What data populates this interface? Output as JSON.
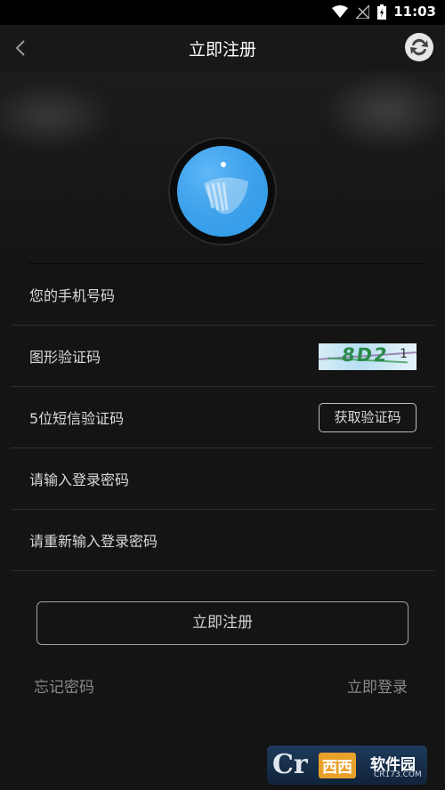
{
  "status_bar": {
    "time": "11:03",
    "icons": [
      "wifi-icon",
      "no-signal-icon",
      "battery-icon"
    ]
  },
  "app_bar": {
    "title": "立即注册",
    "back_icon": "chevron-left-icon",
    "refresh_icon": "refresh-icon"
  },
  "form": {
    "phone_placeholder": "您的手机号码",
    "captcha_placeholder": "图形验证码",
    "captcha_image_text": "8D2",
    "captcha_image_suffix": "1",
    "sms_placeholder": "5位短信验证码",
    "get_code_label": "获取验证码",
    "password_placeholder": "请输入登录密码",
    "confirm_password_placeholder": "请重新输入登录密码"
  },
  "actions": {
    "register_label": "立即注册",
    "forgot_password_label": "忘记密码",
    "login_label": "立即登录"
  },
  "watermark": {
    "logo_text": "Cr",
    "badge_text": "西西",
    "brand_text": "软件园",
    "url_text": "CR173.COM"
  },
  "colors": {
    "background": "#141414",
    "avatar_blue": "#3aa3ee",
    "captcha_text": "#2c8a4b"
  }
}
